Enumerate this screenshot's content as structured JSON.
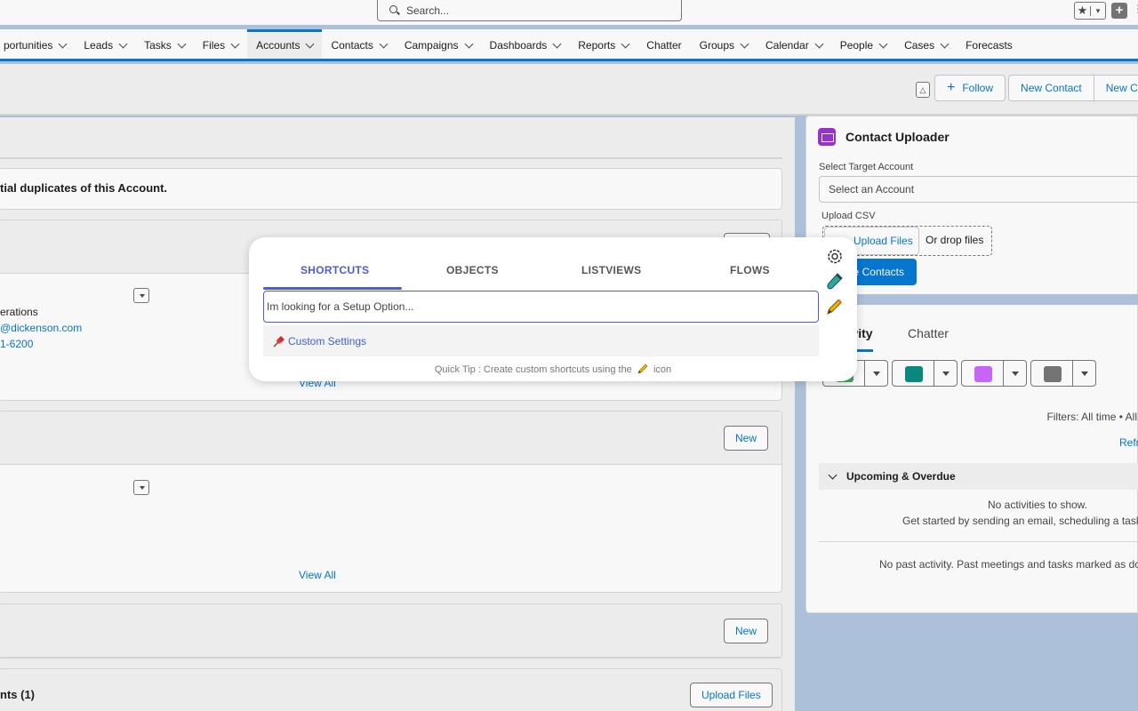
{
  "header": {
    "search_placeholder": "Search...",
    "favorites_star": "★",
    "favorites_caret": "▾",
    "plus": "+"
  },
  "nav": {
    "items": [
      {
        "label": "portunities",
        "chevron": true
      },
      {
        "label": "Leads",
        "chevron": true
      },
      {
        "label": "Tasks",
        "chevron": true
      },
      {
        "label": "Files",
        "chevron": true
      },
      {
        "label": "Accounts",
        "chevron": true,
        "active": true
      },
      {
        "label": "Contacts",
        "chevron": true
      },
      {
        "label": "Campaigns",
        "chevron": true
      },
      {
        "label": "Dashboards",
        "chevron": true
      },
      {
        "label": "Reports",
        "chevron": true
      },
      {
        "label": "Chatter",
        "chevron": false
      },
      {
        "label": "Groups",
        "chevron": true
      },
      {
        "label": "Calendar",
        "chevron": true
      },
      {
        "label": "People",
        "chevron": true
      },
      {
        "label": "Cases",
        "chevron": true
      },
      {
        "label": "Forecasts",
        "chevron": false
      }
    ]
  },
  "record_header": {
    "follow_label": "Follow",
    "new_contact_label": "New Contact",
    "new_case_label": "New Cas"
  },
  "left": {
    "duplicates_text": "tial duplicates of this Account.",
    "contact_role": "erations",
    "contact_email": "@dickenson.com",
    "contact_phone": "1-6200",
    "view_all_1": "View All",
    "view_all_2": "View All",
    "new_label_1": "New",
    "new_label_2": "New",
    "attachments_title": "nts (1)",
    "upload_files_label": "Upload Files"
  },
  "contact_uploader": {
    "title": "Contact Uploader",
    "select_target_label": "Select Target Account",
    "select_placeholder": "Select an Account",
    "upload_csv_label": "Upload CSV",
    "upload_files_label": "Upload Files",
    "drop_text": "Or drop files",
    "create_contacts_label": "e Contacts"
  },
  "activity": {
    "tabs": [
      "Activity",
      "Chatter"
    ],
    "filters_text": "Filters: All time • All a",
    "refresh_label": "Refresh",
    "upcoming_label": "Upcoming & Overdue",
    "no_activities": "No activities to show.",
    "get_started": "Get started by sending an email, scheduling a task, and",
    "no_past": "No past activity. Past meetings and tasks marked as done s"
  },
  "modal": {
    "tabs": [
      "SHORTCUTS",
      "OBJECTS",
      "LISTVIEWS",
      "FLOWS"
    ],
    "active_tab": "SHORTCUTS",
    "search_placeholder": "Im looking for a Setup Option...",
    "result_label": "Custom Settings",
    "tip_before": "Quick Tip : Create custom shortcuts using the",
    "tip_after": "icon",
    "side_icons": [
      "settings-icon",
      "test-tube-icon",
      "pencil-icon"
    ]
  },
  "colors": {
    "brand_blue": "#0176d3",
    "modal_accent": "#4d5bd8",
    "uploader_icon": "#9b2fd1",
    "call_icon": "#048a7e",
    "event_icon": "#cb65ff",
    "email_icon": "#747474",
    "task_icon": "#3ba755"
  }
}
